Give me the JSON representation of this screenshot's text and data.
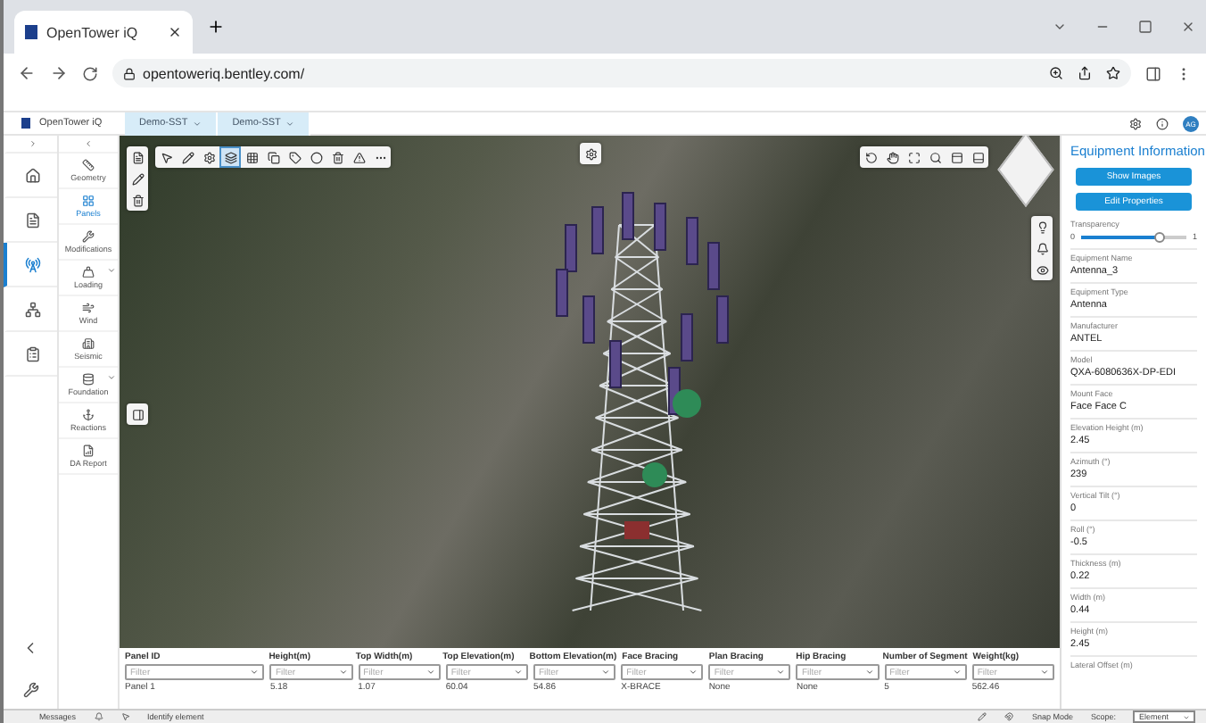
{
  "browser": {
    "tab_title": "OpenTower iQ",
    "url": "opentoweriq.bentley.com/"
  },
  "app": {
    "title": "OpenTower iQ",
    "breadcrumbs": [
      "Demo-SST",
      "Demo-SST"
    ],
    "avatar": "AG"
  },
  "rail": [
    {
      "selected": false
    },
    {
      "selected": false
    },
    {
      "selected": true
    },
    {
      "selected": false
    },
    {
      "selected": false
    }
  ],
  "sidebar": {
    "items": [
      {
        "label": "Geometry",
        "selected": false,
        "expandable": false
      },
      {
        "label": "Panels",
        "selected": true,
        "expandable": false
      },
      {
        "label": "Modifications",
        "selected": false,
        "expandable": false
      },
      {
        "label": "Loading",
        "selected": false,
        "expandable": true
      },
      {
        "label": "Wind",
        "selected": false,
        "expandable": false
      },
      {
        "label": "Seismic",
        "selected": false,
        "expandable": false
      },
      {
        "label": "Foundation",
        "selected": false,
        "expandable": true
      },
      {
        "label": "Reactions",
        "selected": false,
        "expandable": false
      },
      {
        "label": "DA Report",
        "selected": false,
        "expandable": false
      }
    ]
  },
  "toolbar": [
    {
      "selected": false
    },
    {
      "selected": false
    },
    {
      "selected": false
    },
    {
      "selected": true
    },
    {
      "selected": false
    },
    {
      "selected": false
    },
    {
      "selected": false
    },
    {
      "selected": false
    },
    {
      "selected": false
    },
    {
      "selected": false
    },
    {
      "selected": false
    }
  ],
  "table": {
    "columns": [
      "Panel ID",
      "Height(m)",
      "Top Width(m)",
      "Top Elevation(m)",
      "Bottom Elevation(m)",
      "Face Bracing",
      "Plan Bracing",
      "Hip Bracing",
      "Number of Segment",
      "Weight(kg)"
    ],
    "filters": [
      "Filter",
      "Filter",
      "Filter",
      "Filter",
      "Filter",
      "Filter",
      "Filter",
      "Filter",
      "Filter",
      "Filter"
    ],
    "rows": [
      [
        "Panel 1",
        "5.18",
        "1.07",
        "60.04",
        "54.86",
        "X-BRACE",
        "None",
        "None",
        "5",
        "562.46"
      ]
    ]
  },
  "status_bar": {
    "messages": "Messages",
    "identify": "Identify element",
    "snap": "Snap Mode",
    "scope_label": "Scope:",
    "scope_value": "Element"
  },
  "panel": {
    "title": "Equipment Information",
    "buttons": [
      "Show Images",
      "Edit Properties"
    ],
    "transparency": {
      "label": "Transparency",
      "level": 0.75,
      "min": "0",
      "max": "1"
    },
    "fields": [
      {
        "label": "Equipment Name",
        "value": "Antenna_3"
      },
      {
        "label": "Equipment Type",
        "value": "Antenna"
      },
      {
        "label": "Manufacturer",
        "value": "ANTEL"
      },
      {
        "label": "Model",
        "value": "QXA-6080636X-DP-EDI"
      },
      {
        "label": "Mount Face",
        "value": "Face Face C"
      },
      {
        "label": "Elevation Height (m)",
        "value": "2.45"
      },
      {
        "label": "Azimuth (°)",
        "value": "239"
      },
      {
        "label": "Vertical Tilt (°)",
        "value": "0"
      },
      {
        "label": "Roll (°)",
        "value": "-0.5"
      },
      {
        "label": "Thickness (m)",
        "value": "0.22"
      },
      {
        "label": "Width (m)",
        "value": "0.44"
      },
      {
        "label": "Height (m)",
        "value": "2.45"
      },
      {
        "label": "Lateral Offset (m)"
      }
    ]
  }
}
